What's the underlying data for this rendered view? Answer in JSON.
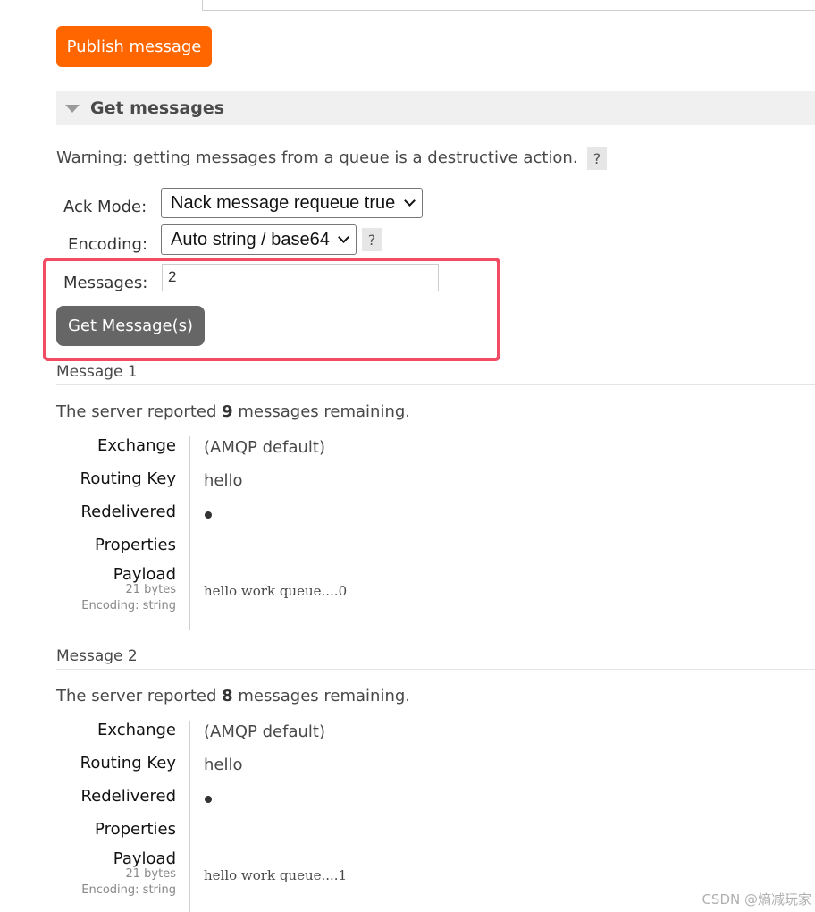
{
  "publish_button": "Publish message",
  "section_title": "Get messages",
  "warning": "Warning: getting messages from a queue is a destructive action.",
  "help_label": "?",
  "ack_mode": {
    "label": "Ack Mode:",
    "selected": "Nack message requeue true"
  },
  "encoding": {
    "label": "Encoding:",
    "selected": "Auto string / base64"
  },
  "messages": {
    "label": "Messages:",
    "value": "2"
  },
  "get_button": "Get Message(s)",
  "field_labels": {
    "exchange": "Exchange",
    "routing_key": "Routing Key",
    "redelivered": "Redelivered",
    "properties": "Properties",
    "payload": "Payload"
  },
  "results": [
    {
      "title": "Message 1",
      "remaining_prefix": "The server reported",
      "remaining_count": "9",
      "remaining_suffix": "messages remaining.",
      "exchange": "(AMQP default)",
      "routing_key": "hello",
      "payload_bytes": "21 bytes",
      "payload_encoding": "Encoding: string",
      "payload": "hello work queue....0"
    },
    {
      "title": "Message 2",
      "remaining_prefix": "The server reported",
      "remaining_count": "8",
      "remaining_suffix": "messages remaining.",
      "exchange": "(AMQP default)",
      "routing_key": "hello",
      "payload_bytes": "21 bytes",
      "payload_encoding": "Encoding: string",
      "payload": "hello work queue....1"
    }
  ],
  "watermark": "CSDN @熵减玩家"
}
